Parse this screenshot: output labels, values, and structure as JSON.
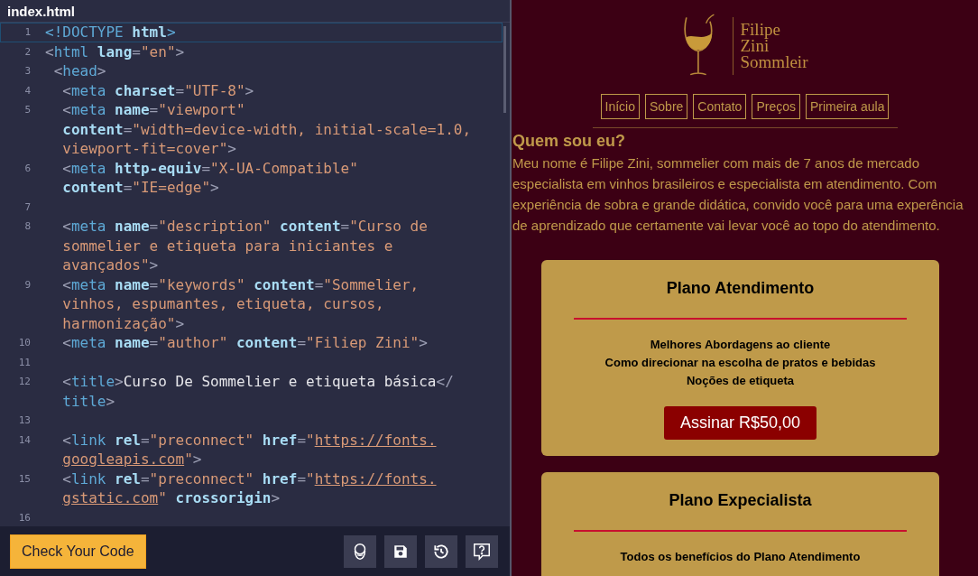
{
  "editor": {
    "file_tab": "index.html",
    "lines": [
      {
        "number": "1",
        "active": true,
        "rows": [
          {
            "tokens": [
              {
                "kind": "tag",
                "text": "<!DOCTYPE"
              },
              {
                "kind": "attr",
                "text": " html"
              },
              {
                "kind": "tag",
                "text": ">"
              }
            ]
          }
        ]
      },
      {
        "number": "2",
        "active": false,
        "rows": [
          {
            "tokens": [
              {
                "kind": "punct",
                "text": "<"
              },
              {
                "kind": "tag",
                "text": "html"
              },
              {
                "kind": "attr",
                "text": " lang"
              },
              {
                "kind": "punct",
                "text": "="
              },
              {
                "kind": "string",
                "text": "\"en\""
              },
              {
                "kind": "punct",
                "text": ">"
              }
            ]
          }
        ]
      },
      {
        "number": "3",
        "active": false,
        "rows": [
          {
            "tokens": [
              {
                "kind": "punct",
                "text": " <"
              },
              {
                "kind": "tag",
                "text": "head"
              },
              {
                "kind": "punct",
                "text": ">"
              }
            ]
          }
        ]
      },
      {
        "number": "4",
        "active": false,
        "rows": [
          {
            "tokens": [
              {
                "kind": "punct",
                "text": "  <"
              },
              {
                "kind": "tag",
                "text": "meta"
              },
              {
                "kind": "attr",
                "text": " charset"
              },
              {
                "kind": "punct",
                "text": "="
              },
              {
                "kind": "string",
                "text": "\"UTF-8\""
              },
              {
                "kind": "punct",
                "text": ">"
              }
            ]
          }
        ]
      },
      {
        "number": "5",
        "active": false,
        "rows": [
          {
            "tokens": [
              {
                "kind": "punct",
                "text": "  <"
              },
              {
                "kind": "tag",
                "text": "meta"
              },
              {
                "kind": "attr",
                "text": " name"
              },
              {
                "kind": "punct",
                "text": "="
              },
              {
                "kind": "string",
                "text": "\"viewport\""
              }
            ]
          },
          {
            "tokens": [
              {
                "kind": "attr",
                "text": "  content"
              },
              {
                "kind": "punct",
                "text": "="
              },
              {
                "kind": "string",
                "text": "\"width=device-width, initial-scale=1.0,"
              }
            ]
          },
          {
            "tokens": [
              {
                "kind": "string",
                "text": "  viewport-fit=cover\""
              },
              {
                "kind": "punct",
                "text": ">"
              }
            ]
          }
        ]
      },
      {
        "number": "6",
        "active": false,
        "rows": [
          {
            "tokens": [
              {
                "kind": "punct",
                "text": "  <"
              },
              {
                "kind": "tag",
                "text": "meta"
              },
              {
                "kind": "attr",
                "text": " http-equiv"
              },
              {
                "kind": "punct",
                "text": "="
              },
              {
                "kind": "string",
                "text": "\"X-UA-Compatible\""
              }
            ]
          },
          {
            "tokens": [
              {
                "kind": "attr",
                "text": "  content"
              },
              {
                "kind": "punct",
                "text": "="
              },
              {
                "kind": "string",
                "text": "\"IE=edge\""
              },
              {
                "kind": "punct",
                "text": ">"
              }
            ]
          }
        ]
      },
      {
        "number": "7",
        "active": false
      },
      {
        "number": "8",
        "active": false,
        "rows": [
          {
            "tokens": [
              {
                "kind": "punct",
                "text": "  <"
              },
              {
                "kind": "tag",
                "text": "meta"
              },
              {
                "kind": "attr",
                "text": " name"
              },
              {
                "kind": "punct",
                "text": "="
              },
              {
                "kind": "string",
                "text": "\"description\""
              },
              {
                "kind": "attr",
                "text": " content"
              },
              {
                "kind": "punct",
                "text": "="
              },
              {
                "kind": "string",
                "text": "\"Curso de"
              }
            ]
          },
          {
            "tokens": [
              {
                "kind": "string",
                "text": "  sommelier e etiqueta para iniciantes e"
              }
            ]
          },
          {
            "tokens": [
              {
                "kind": "string",
                "text": "  avançados\""
              },
              {
                "kind": "punct",
                "text": ">"
              }
            ]
          }
        ]
      },
      {
        "number": "9",
        "active": false,
        "rows": [
          {
            "tokens": [
              {
                "kind": "punct",
                "text": "  <"
              },
              {
                "kind": "tag",
                "text": "meta"
              },
              {
                "kind": "attr",
                "text": " name"
              },
              {
                "kind": "punct",
                "text": "="
              },
              {
                "kind": "string",
                "text": "\"keywords\""
              },
              {
                "kind": "attr",
                "text": " content"
              },
              {
                "kind": "punct",
                "text": "="
              },
              {
                "kind": "string",
                "text": "\"Sommelier,"
              }
            ]
          },
          {
            "tokens": [
              {
                "kind": "string",
                "text": "  vinhos, espumantes, etiqueta, cursos,"
              }
            ]
          },
          {
            "tokens": [
              {
                "kind": "string",
                "text": "  harmonização\""
              },
              {
                "kind": "punct",
                "text": ">"
              }
            ]
          }
        ]
      },
      {
        "number": "10",
        "active": false,
        "rows": [
          {
            "tokens": [
              {
                "kind": "punct",
                "text": "  <"
              },
              {
                "kind": "tag",
                "text": "meta"
              },
              {
                "kind": "attr",
                "text": " name"
              },
              {
                "kind": "punct",
                "text": "="
              },
              {
                "kind": "string",
                "text": "\"author\""
              },
              {
                "kind": "attr",
                "text": " content"
              },
              {
                "kind": "punct",
                "text": "="
              },
              {
                "kind": "string",
                "text": "\"Filiep Zini\""
              },
              {
                "kind": "punct",
                "text": ">"
              }
            ]
          }
        ]
      },
      {
        "number": "11",
        "active": false
      },
      {
        "number": "12",
        "active": false,
        "rows": [
          {
            "tokens": [
              {
                "kind": "punct",
                "text": "  <"
              },
              {
                "kind": "tag",
                "text": "title"
              },
              {
                "kind": "punct",
                "text": ">"
              },
              {
                "kind": "text",
                "text": "Curso De Sommelier e etiqueta básica"
              },
              {
                "kind": "punct",
                "text": "</"
              }
            ]
          },
          {
            "tokens": [
              {
                "kind": "tag",
                "text": "  title"
              },
              {
                "kind": "punct",
                "text": ">"
              }
            ]
          }
        ]
      },
      {
        "number": "13",
        "active": false
      },
      {
        "number": "14",
        "active": false,
        "rows": [
          {
            "tokens": [
              {
                "kind": "punct",
                "text": "  <"
              },
              {
                "kind": "tag",
                "text": "link"
              },
              {
                "kind": "attr",
                "text": " rel"
              },
              {
                "kind": "punct",
                "text": "="
              },
              {
                "kind": "string",
                "text": "\"preconnect\""
              },
              {
                "kind": "attr",
                "text": " href"
              },
              {
                "kind": "punct",
                "text": "="
              },
              {
                "kind": "string",
                "text": "\""
              },
              {
                "kind": "link",
                "text": "https://fonts."
              }
            ]
          },
          {
            "tokens": [
              {
                "kind": "link",
                "text": "  googleapis.com"
              },
              {
                "kind": "string",
                "text": "\""
              },
              {
                "kind": "punct",
                "text": ">"
              }
            ]
          }
        ]
      },
      {
        "number": "15",
        "active": false,
        "rows": [
          {
            "tokens": [
              {
                "kind": "punct",
                "text": "  <"
              },
              {
                "kind": "tag",
                "text": "link"
              },
              {
                "kind": "attr",
                "text": " rel"
              },
              {
                "kind": "punct",
                "text": "="
              },
              {
                "kind": "string",
                "text": "\"preconnect\""
              },
              {
                "kind": "attr",
                "text": " href"
              },
              {
                "kind": "punct",
                "text": "="
              },
              {
                "kind": "string",
                "text": "\""
              },
              {
                "kind": "link",
                "text": "https://fonts."
              }
            ]
          },
          {
            "tokens": [
              {
                "kind": "link",
                "text": "  gstatic.com"
              },
              {
                "kind": "string",
                "text": "\""
              },
              {
                "kind": "attr",
                "text": " crossorigin"
              },
              {
                "kind": "punct",
                "text": ">"
              }
            ]
          }
        ]
      },
      {
        "number": "16",
        "active": false
      }
    ],
    "check_button": "Check Your Code",
    "tools": [
      {
        "kind": "avatar"
      },
      {
        "kind": "save"
      },
      {
        "kind": "history"
      },
      {
        "kind": "help"
      }
    ]
  },
  "preview": {
    "logo": [
      "Filipe",
      "Zini",
      "Sommleir"
    ],
    "nav": [
      "Início",
      "Sobre",
      "Contato",
      "Preços",
      "Primeira aula"
    ],
    "heading": "Quem sou eu?",
    "intro": "Meu nome é Filipe Zini, sommelier com mais de 7 anos de mercado especialista em vinhos brasileiros e especialista em atendimento. Com experiência de sobra e grande didática, convido você para uma experência de aprendizado que certamente vai levar você ao topo do atendimento.",
    "plans": [
      {
        "title": "Plano Atendimento",
        "features": [
          "Melhores Abordagens ao cliente",
          "Como direcionar na escolha de pratos e bebidas",
          "Noções de etiqueta"
        ],
        "button": "Assinar R$50,00"
      },
      {
        "title": "Plano Expecialista",
        "features": [
          "Todos os benefícios do Plano Atendimento"
        ]
      }
    ]
  }
}
